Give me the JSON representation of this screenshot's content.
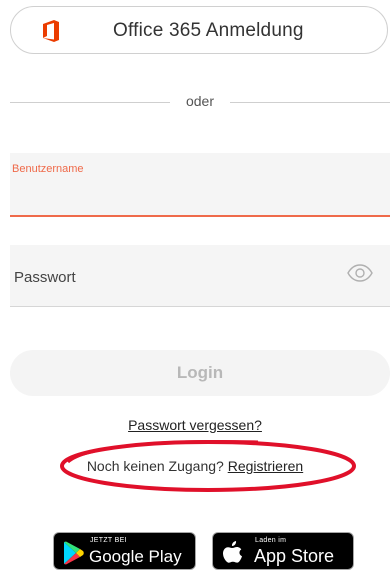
{
  "office_button": {
    "label": "Office 365 Anmeldung",
    "icon": "office-logo-icon",
    "icon_color": "#eb3c00"
  },
  "divider": {
    "label": "oder"
  },
  "username_field": {
    "label": "Benutzername",
    "value": "",
    "accent_color": "#ef6a4a"
  },
  "password_field": {
    "placeholder": "Passwort",
    "toggle_icon": "eye-icon"
  },
  "login_button": {
    "label": "Login"
  },
  "forgot_password": {
    "label": "Passwort vergessen?"
  },
  "register": {
    "prompt": "Noch keinen Zugang?",
    "link_label": "Registrieren",
    "annotation_color": "#e0102a"
  },
  "store_badges": {
    "google": {
      "small_text": "JETZT BEI",
      "big_text": "Google Play",
      "icon": "google-play-icon"
    },
    "apple": {
      "small_text": "Laden im",
      "big_text": "App Store",
      "icon": "apple-icon"
    }
  }
}
